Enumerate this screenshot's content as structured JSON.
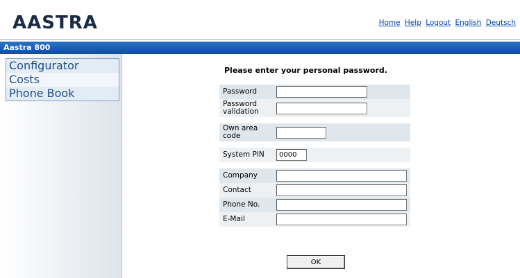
{
  "header": {
    "logo_text": "AASTRA",
    "links": [
      "Home",
      "Help",
      "Logout",
      "English",
      "Deutsch"
    ]
  },
  "titlebar": {
    "text": "Aastra 800"
  },
  "sidebar": {
    "items": [
      {
        "label": "Configurator"
      },
      {
        "label": "Costs"
      },
      {
        "label": "Phone Book"
      }
    ]
  },
  "form": {
    "title": "Please enter your personal password.",
    "password_label": "Password",
    "password_value": "",
    "password_validation_label": "Password validation",
    "password_validation_value": "",
    "own_area_code_label": "Own area code",
    "own_area_code_value": "",
    "system_pin_label": "System PIN",
    "system_pin_value": "0000",
    "company_label": "Company",
    "company_value": "",
    "contact_label": "Contact",
    "contact_value": "",
    "phone_label": "Phone No.",
    "phone_value": "",
    "email_label": "E-Mail",
    "email_value": "",
    "ok_label": "OK"
  }
}
